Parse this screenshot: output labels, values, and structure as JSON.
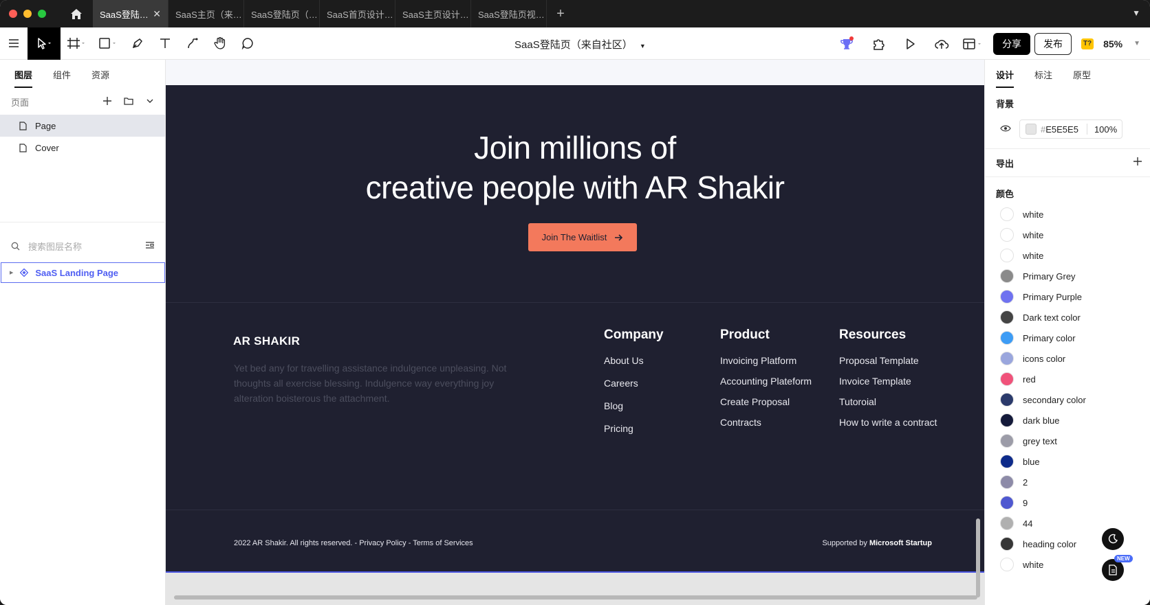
{
  "window": {
    "tabs": [
      {
        "label": "SaaS登陆…",
        "active": true
      },
      {
        "label": "SaaS主页（来…",
        "active": false
      },
      {
        "label": "SaaS登陆页（…",
        "active": false
      },
      {
        "label": "SaaS首页设计…",
        "active": false
      },
      {
        "label": "SaaS主页设计…",
        "active": false
      },
      {
        "label": "SaaS登陆页视…",
        "active": false
      }
    ]
  },
  "toolbar": {
    "doc_title": "SaaS登陆页（来自社区）",
    "share_label": "分享",
    "publish_label": "发布",
    "ai_badge": "T?",
    "zoom": "85%"
  },
  "left_panel": {
    "tabs": [
      "图层",
      "组件",
      "资源"
    ],
    "pages_label": "页面",
    "pages": [
      "Page",
      "Cover"
    ],
    "search_placeholder": "搜索图层名称",
    "layer": "SaaS Landing Page"
  },
  "canvas": {
    "hero_line1": "Join millions of",
    "hero_line2": "creative people with AR Shakir",
    "cta_label": "Join The Waitlist",
    "brand": "AR SHAKIR",
    "about": "Yet bed any for travelling assistance indulgence unpleasing. Not thoughts all exercise blessing. Indulgence way everything joy alteration boisterous the attachment.",
    "columns": [
      {
        "title": "Company",
        "links": [
          "About Us",
          "Careers",
          "Blog",
          "Pricing"
        ]
      },
      {
        "title": "Product",
        "links": [
          "Invoicing Platform",
          "Accounting Plateform",
          "Create Proposal",
          "Contracts"
        ]
      },
      {
        "title": "Resources",
        "links": [
          "Proposal Template",
          "Invoice Template",
          "Tutoroial",
          "How to write a contract"
        ]
      }
    ],
    "copyright": "2022 AR Shakir. All rights reserved. - Privacy Policy - Terms of Services",
    "supported_prefix": "Supported by",
    "supported_brand": "Microsoft Startup"
  },
  "right_panel": {
    "tabs": [
      "设计",
      "标注",
      "原型"
    ],
    "background_label": "背景",
    "bg_hex": "E5E5E5",
    "bg_opacity": "100%",
    "export_label": "导出",
    "colors_label": "颜色",
    "colors": [
      {
        "name": "white",
        "hex": "#ffffff"
      },
      {
        "name": "white",
        "hex": "#ffffff"
      },
      {
        "name": "white",
        "hex": "#ffffff"
      },
      {
        "name": "Primary Grey",
        "hex": "#8a8a8a"
      },
      {
        "name": "Primary Purple",
        "hex": "#6f72f0"
      },
      {
        "name": "Dark text color",
        "hex": "#444444"
      },
      {
        "name": "Primary color",
        "hex": "#3d9cf5"
      },
      {
        "name": "icons color",
        "hex": "#9aa6dd"
      },
      {
        "name": "red",
        "hex": "#f0527a"
      },
      {
        "name": "secondary color",
        "hex": "#2b3a6b"
      },
      {
        "name": "dark blue",
        "hex": "#141a3a"
      },
      {
        "name": "grey text",
        "hex": "#9c9ca8"
      },
      {
        "name": "blue",
        "hex": "#0e2b8a"
      },
      {
        "name": "2",
        "hex": "#8d8ba8"
      },
      {
        "name": "9",
        "hex": "#4f58d0"
      },
      {
        "name": "44",
        "hex": "#b0b0b0"
      },
      {
        "name": "heading color",
        "hex": "#363636"
      },
      {
        "name": "white",
        "hex": "#ffffff"
      }
    ],
    "new_badge": "NEW"
  }
}
